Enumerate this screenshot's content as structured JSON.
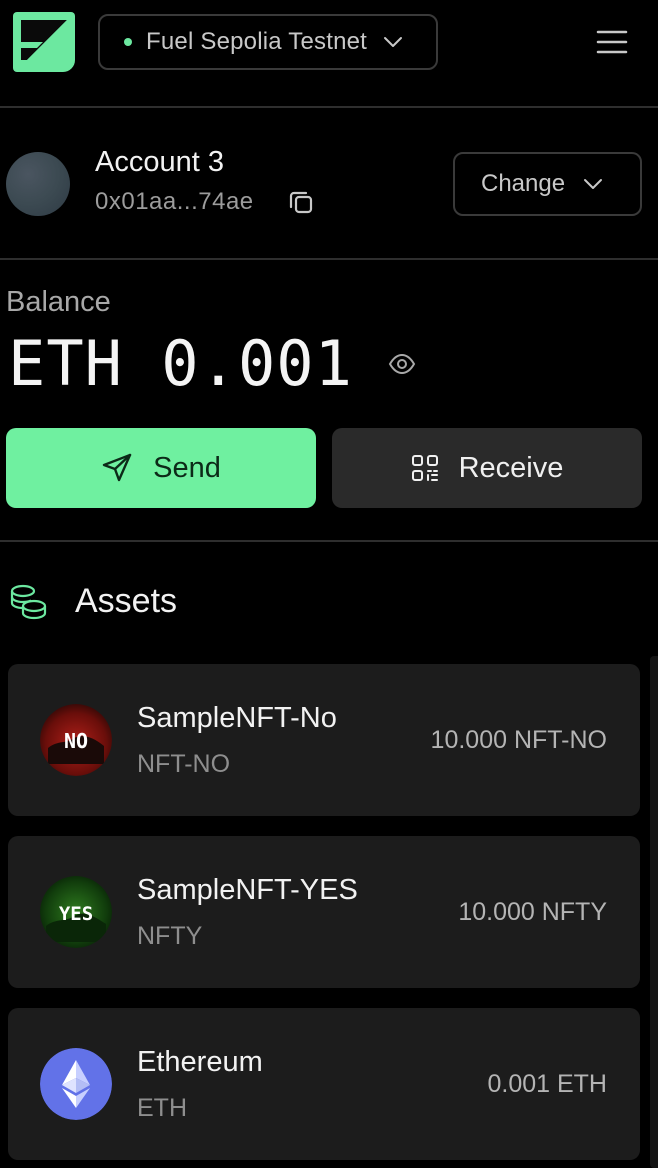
{
  "header": {
    "network_label": "Fuel Sepolia Testnet",
    "network_status_color": "#6ce8a0",
    "brand_color": "#6ce8a0",
    "menu_icon": "hamburger-menu-icon"
  },
  "account": {
    "name": "Account 3",
    "address": "0x01aa...74ae",
    "change_label": "Change"
  },
  "balance": {
    "label": "Balance",
    "value": "ETH 0.001"
  },
  "actions": {
    "send_label": "Send",
    "receive_label": "Receive",
    "send_color": "#6ff0a0"
  },
  "assets": {
    "title": "Assets",
    "items": [
      {
        "name": "SampleNFT-No",
        "symbol": "NFT-NO",
        "amount": "10.000 NFT-NO",
        "badge": "NO"
      },
      {
        "name": "SampleNFT-YES",
        "symbol": "NFTY",
        "amount": "10.000 NFTY",
        "badge": "YES"
      },
      {
        "name": "Ethereum",
        "symbol": "ETH",
        "amount": "0.001 ETH",
        "badge": ""
      }
    ]
  }
}
